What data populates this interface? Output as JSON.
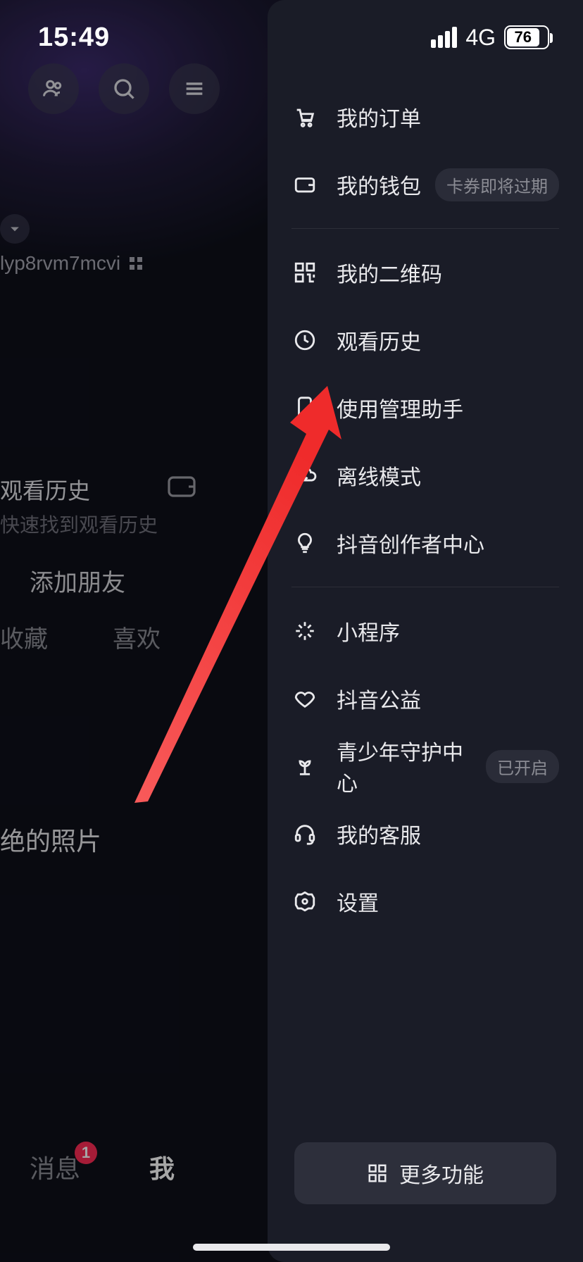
{
  "status": {
    "time": "15:49",
    "network": "4G",
    "battery": "76"
  },
  "underlay": {
    "uid": "lyp8rvm7mcvi",
    "history_title": "观看历史",
    "history_sub": "快速找到观看历史",
    "add_friend": "添加朋友",
    "tab_collect": "收藏",
    "tab_like": "喜欢",
    "photos": "绝的照片"
  },
  "nav": {
    "messages": "消息",
    "badge": "1",
    "me": "我"
  },
  "drawer": {
    "items": [
      {
        "label": "我的订单",
        "icon": "cart"
      },
      {
        "label": "我的钱包",
        "icon": "wallet",
        "badge": "卡券即将过期"
      },
      {
        "divider": true
      },
      {
        "label": "我的二维码",
        "icon": "qr"
      },
      {
        "label": "观看历史",
        "icon": "clock"
      },
      {
        "label": "使用管理助手",
        "icon": "phone"
      },
      {
        "label": "离线模式",
        "icon": "cloud"
      },
      {
        "label": "抖音创作者中心",
        "icon": "bulb"
      },
      {
        "divider": true
      },
      {
        "label": "小程序",
        "icon": "spark"
      },
      {
        "label": "抖音公益",
        "icon": "heart"
      },
      {
        "label": "青少年守护中心",
        "icon": "sprout",
        "badge": "已开启"
      },
      {
        "label": "我的客服",
        "icon": "headset"
      },
      {
        "label": "设置",
        "icon": "gear"
      }
    ],
    "more": "更多功能"
  }
}
